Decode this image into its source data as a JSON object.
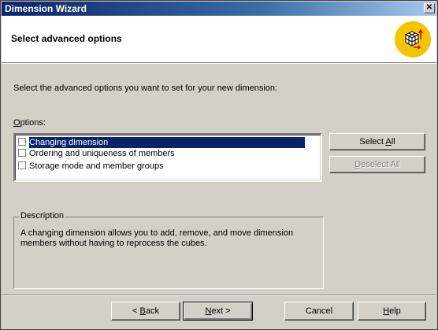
{
  "window": {
    "title": "Dimension Wizard",
    "close_glyph": "✕"
  },
  "header": {
    "title": "Select advanced options",
    "icon": "cube-wizard-icon"
  },
  "intro_text": "Select the advanced options you want to set for your new dimension:",
  "options": {
    "label_prefix": "O",
    "label_rest": "ptions:",
    "items": [
      {
        "label": "Changing dimension",
        "checked": false,
        "selected": true
      },
      {
        "label": "Ordering and uniqueness of members",
        "checked": false,
        "selected": false
      },
      {
        "label": "Storage mode and member groups",
        "checked": false,
        "selected": false
      }
    ]
  },
  "buttons": {
    "select_all_prefix": "Select ",
    "select_all_key": "A",
    "select_all_rest": "ll",
    "deselect_all_key": "D",
    "deselect_all_rest": "eselect All",
    "back_prefix": "< ",
    "back_key": "B",
    "back_rest": "ack",
    "next_key": "N",
    "next_rest": "ext >",
    "cancel": "Cancel",
    "help_key": "H",
    "help_rest": "elp"
  },
  "description": {
    "legend": "Description",
    "text": "A changing dimension allows you to add, remove, and move dimension members without having to reprocess the cubes."
  }
}
